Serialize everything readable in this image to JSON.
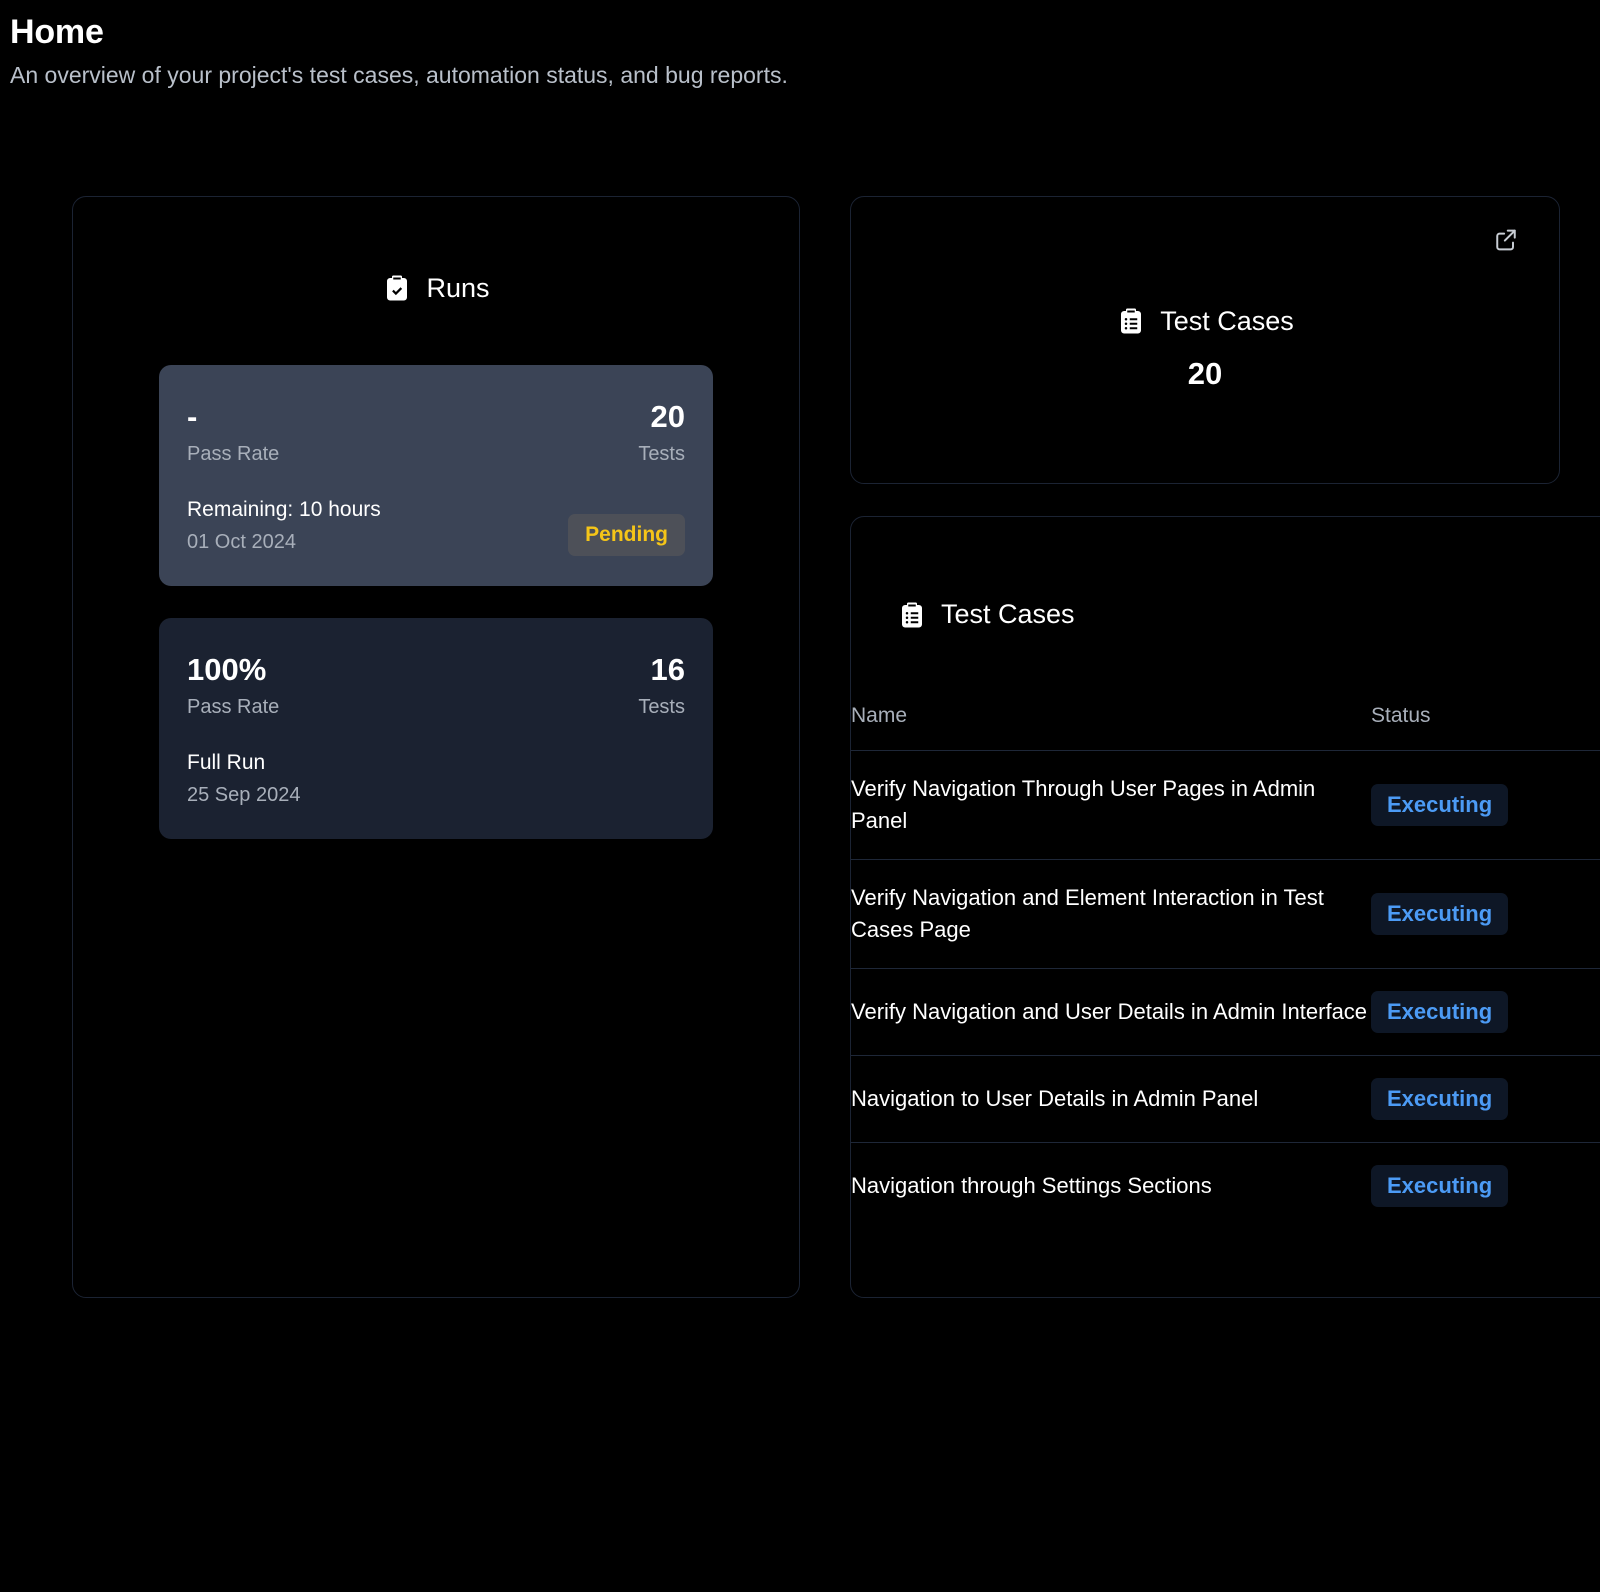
{
  "header": {
    "title": "Home",
    "subtitle": "An overview of your project's test cases, automation status, and bug reports."
  },
  "runs_panel": {
    "heading": "Runs",
    "heading_icon": "clipboard-check-icon",
    "runs": [
      {
        "pass_rate": "-",
        "pass_rate_label": "Pass Rate",
        "tests": "20",
        "tests_label": "Tests",
        "name": "Remaining: 10 hours",
        "date": "01 Oct 2024",
        "status": "Pending",
        "status_color": "#f5c518",
        "status_bg": "#4d5058",
        "card_bg": "#3b4456"
      },
      {
        "pass_rate": "100%",
        "pass_rate_label": "Pass Rate",
        "tests": "16",
        "tests_label": "Tests",
        "name": "Full Run",
        "date": "25 Sep 2024",
        "status": "",
        "card_bg": "#1b2231"
      }
    ]
  },
  "summary_card": {
    "heading": "Test Cases",
    "heading_icon": "clipboard-list-icon",
    "count": "20",
    "external_link_icon": "external-link-icon"
  },
  "table_panel": {
    "heading": "Test Cases",
    "heading_icon": "clipboard-list-icon",
    "columns": [
      "Name",
      "Status"
    ],
    "rows": [
      {
        "name": "Verify Navigation Through User Pages in Admin Panel",
        "status": "Executing"
      },
      {
        "name": "Verify Navigation and Element Interaction in Test Cases Page",
        "status": "Executing"
      },
      {
        "name": "Verify Navigation and User Details in Admin Interface",
        "status": "Executing"
      },
      {
        "name": "Navigation to User Details in Admin Panel",
        "status": "Executing"
      },
      {
        "name": "Navigation through Settings Sections",
        "status": "Executing"
      }
    ],
    "status_color": "#4c9bf5",
    "status_bg": "#0e1726"
  }
}
